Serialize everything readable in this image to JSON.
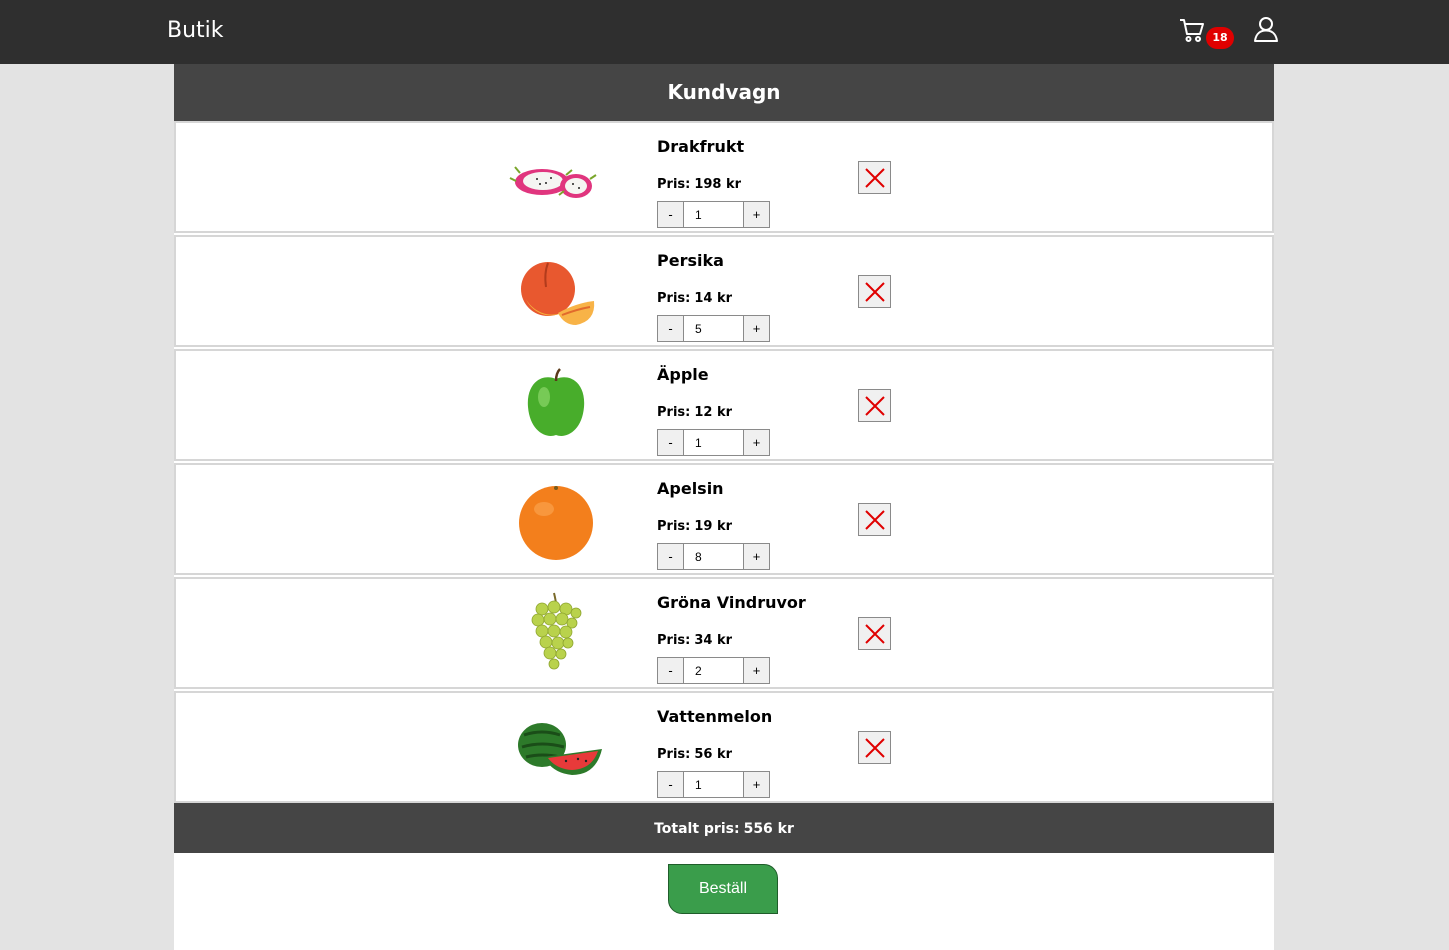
{
  "nav": {
    "brand": "Butik",
    "cart_count": "18"
  },
  "cart": {
    "title": "Kundvagn",
    "price_label": "Pris:",
    "minus_label": "-",
    "plus_label": "+",
    "items": [
      {
        "name": "Drakfrukt",
        "price": "198 kr",
        "quantity": "1"
      },
      {
        "name": "Persika",
        "price": "14 kr",
        "quantity": "5"
      },
      {
        "name": "Äpple",
        "price": "12 kr",
        "quantity": "1"
      },
      {
        "name": "Apelsin",
        "price": "19 kr",
        "quantity": "8"
      },
      {
        "name": "Gröna Vindruvor",
        "price": "34 kr",
        "quantity": "2"
      },
      {
        "name": "Vattenmelon",
        "price": "56 kr",
        "quantity": "1"
      }
    ],
    "total_label": "Totalt pris:",
    "total_value": "556 kr",
    "order_label": "Beställ"
  },
  "icons": {
    "cart": "shopping-cart-icon",
    "user": "user-icon",
    "remove": "close-icon",
    "fruits": [
      "dragonfruit-icon",
      "peach-icon",
      "green-apple-icon",
      "orange-icon",
      "green-grapes-icon",
      "watermelon-icon"
    ]
  },
  "colors": {
    "navbar": "#2f2f2f",
    "header": "#454545",
    "badge": "#e00000",
    "remove_x": "#e00000",
    "order_button": "#3a9d4b"
  }
}
